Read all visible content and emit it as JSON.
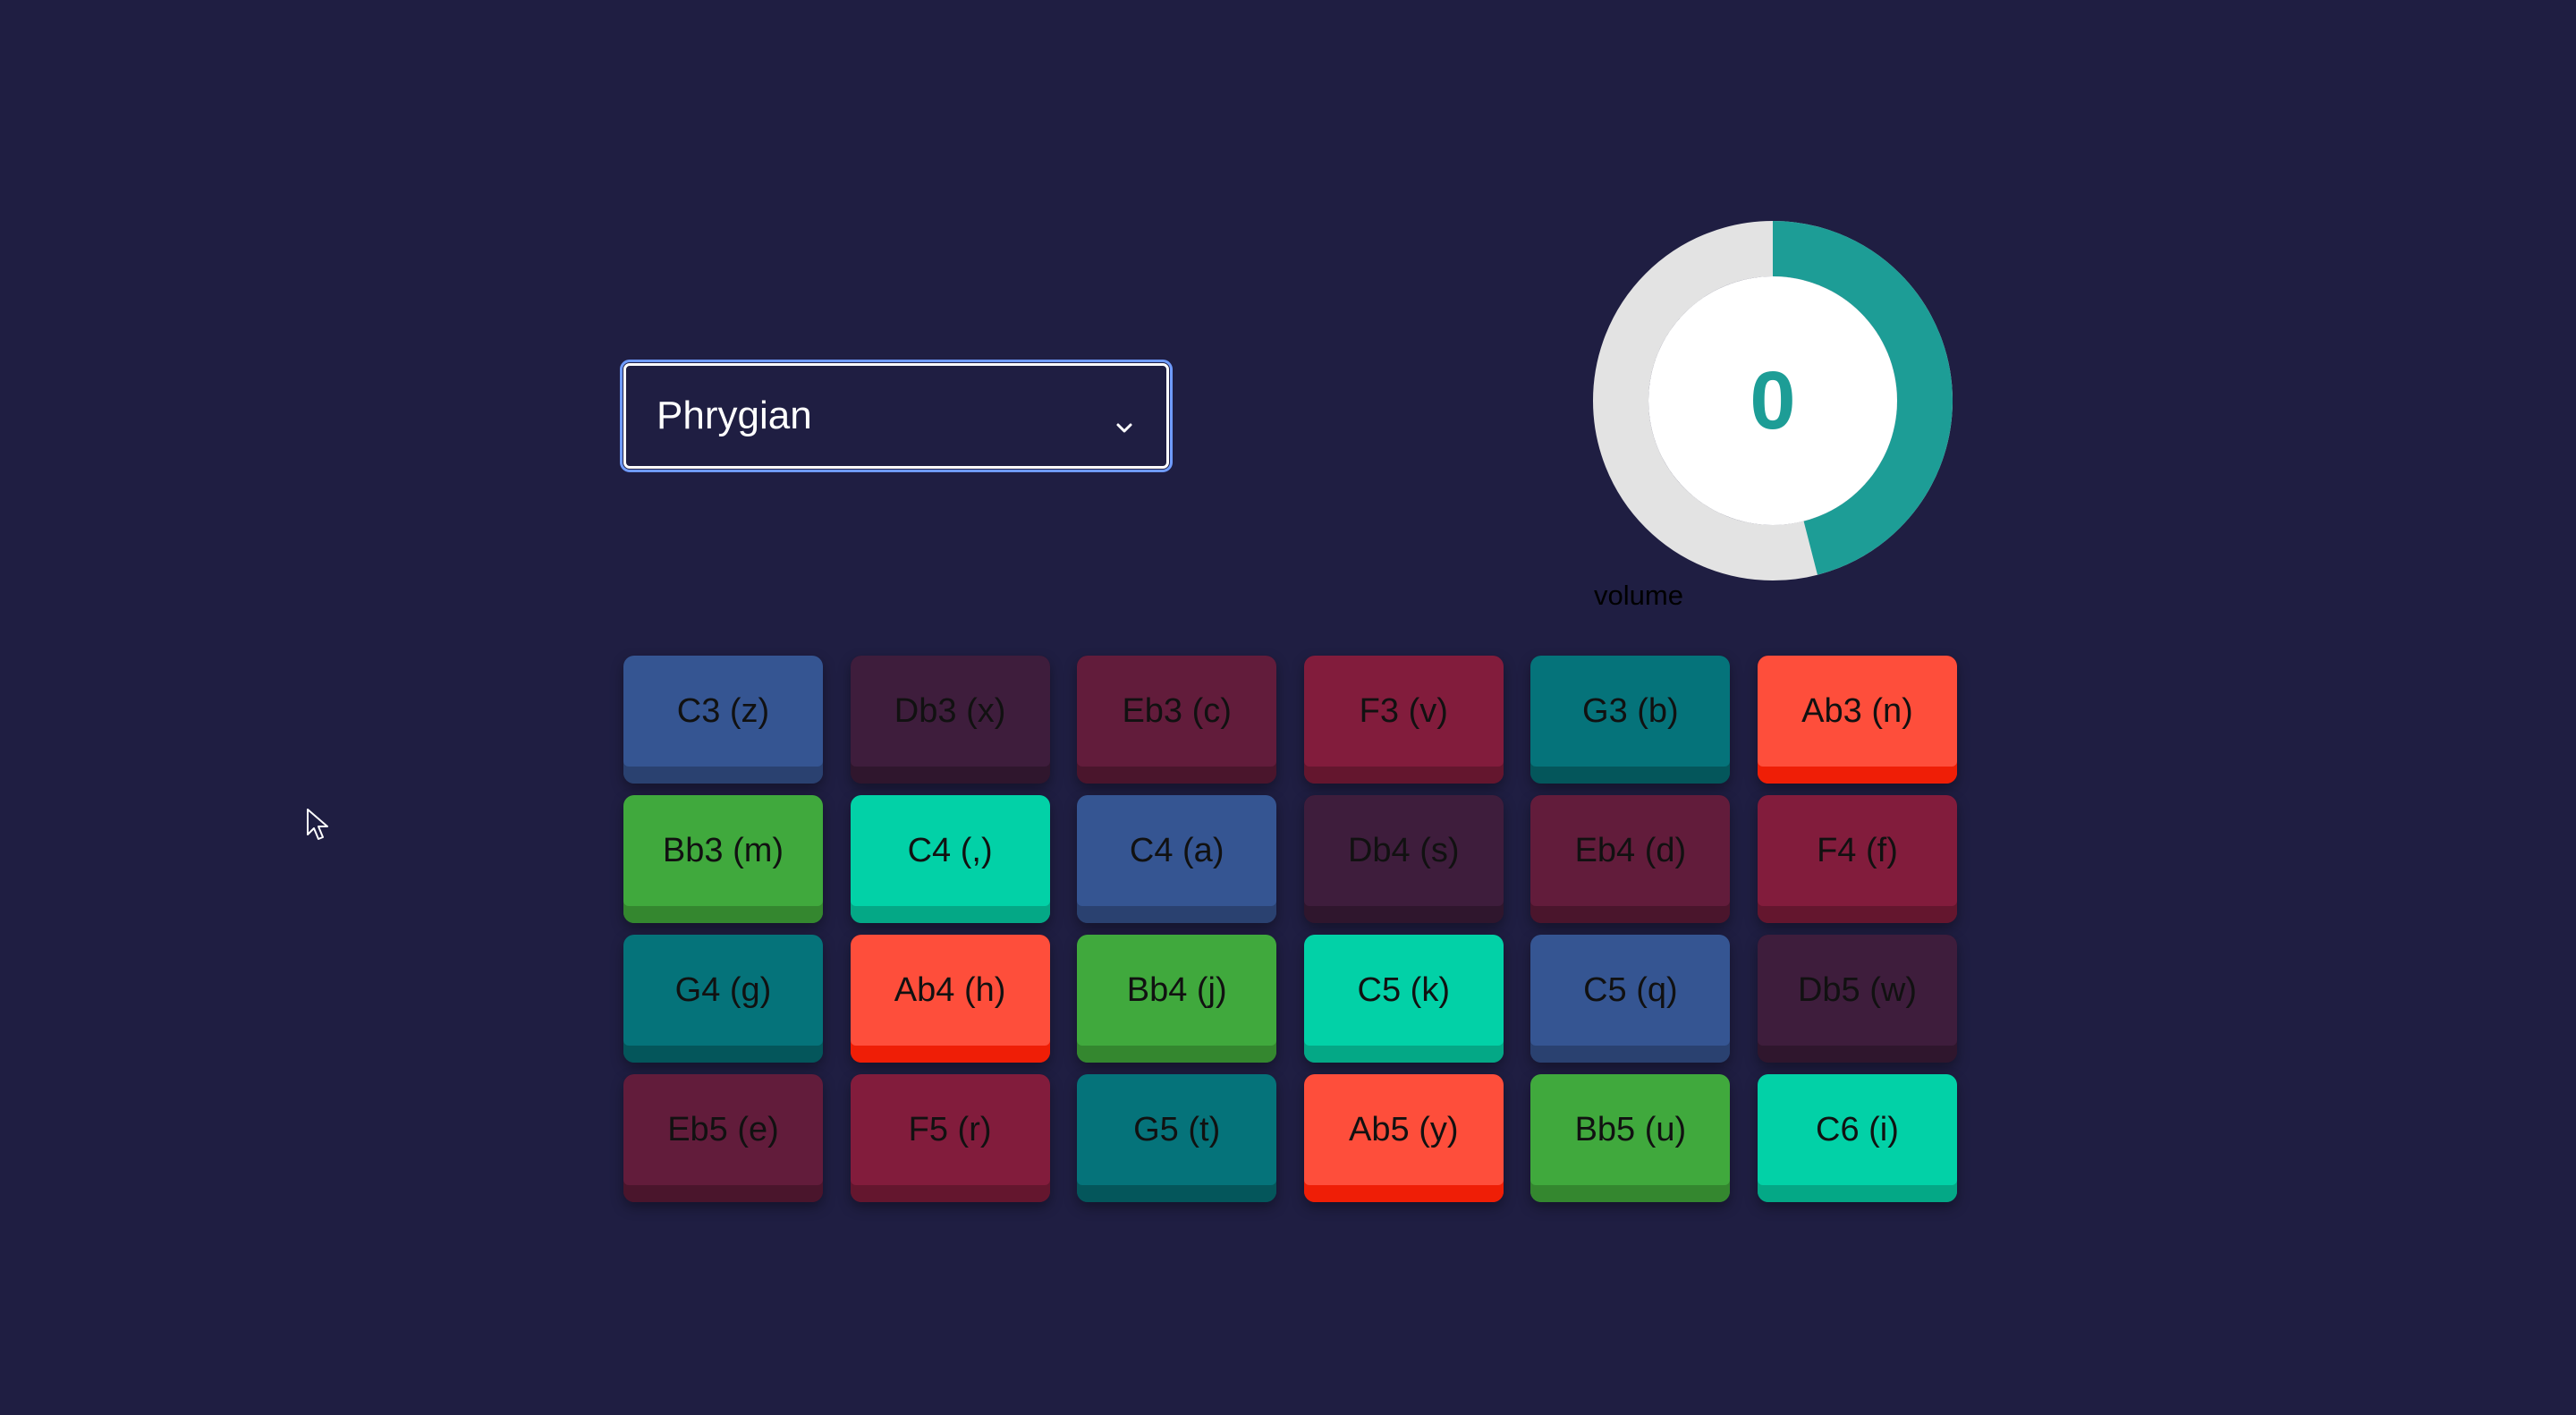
{
  "scale_select": {
    "selected": "Phrygian"
  },
  "volume": {
    "value": "0",
    "label": "volume",
    "level_fraction": 0.46,
    "ring_color": "#1d9d96",
    "track_color": "#e3e3e3"
  },
  "colors": {
    "background": "#1f1e42"
  },
  "pads": [
    {
      "label": "C3 (z)",
      "face": "#355592",
      "lip": "#2a4170"
    },
    {
      "label": "Db3 (x)",
      "face": "#3e1d3c",
      "lip": "#2f162d"
    },
    {
      "label": "Eb3 (c)",
      "face": "#621c3b",
      "lip": "#4a152c"
    },
    {
      "label": "F3 (v)",
      "face": "#821c3c",
      "lip": "#64162e"
    },
    {
      "label": "G3 (b)",
      "face": "#05737a",
      "lip": "#04565b"
    },
    {
      "label": "Ab3 (n)",
      "face": "#fe4e3b",
      "lip": "#ef1e06"
    },
    {
      "label": "Bb3 (m)",
      "face": "#40a93d",
      "lip": "#34872f"
    },
    {
      "label": "C4 (,)",
      "face": "#02d1a7",
      "lip": "#04a886"
    },
    {
      "label": "C4 (a)",
      "face": "#355592",
      "lip": "#2a4170"
    },
    {
      "label": "Db4 (s)",
      "face": "#3e1d3c",
      "lip": "#2f162d"
    },
    {
      "label": "Eb4 (d)",
      "face": "#621c3b",
      "lip": "#4a152c"
    },
    {
      "label": "F4 (f)",
      "face": "#821c3c",
      "lip": "#64162e"
    },
    {
      "label": "G4 (g)",
      "face": "#05737a",
      "lip": "#04565b"
    },
    {
      "label": "Ab4 (h)",
      "face": "#fe4e3b",
      "lip": "#ef1e06"
    },
    {
      "label": "Bb4 (j)",
      "face": "#40a93d",
      "lip": "#34872f"
    },
    {
      "label": "C5 (k)",
      "face": "#02d1a7",
      "lip": "#04a886"
    },
    {
      "label": "C5 (q)",
      "face": "#355592",
      "lip": "#2a4170"
    },
    {
      "label": "Db5 (w)",
      "face": "#3e1d3c",
      "lip": "#2f162d"
    },
    {
      "label": "Eb5 (e)",
      "face": "#621c3b",
      "lip": "#4a152c"
    },
    {
      "label": "F5 (r)",
      "face": "#821c3c",
      "lip": "#64162e"
    },
    {
      "label": "G5 (t)",
      "face": "#05737a",
      "lip": "#04565b"
    },
    {
      "label": "Ab5 (y)",
      "face": "#fe4e3b",
      "lip": "#ef1e06"
    },
    {
      "label": "Bb5 (u)",
      "face": "#40a93d",
      "lip": "#34872f"
    },
    {
      "label": "C6 (i)",
      "face": "#02d1a7",
      "lip": "#04a886"
    }
  ]
}
